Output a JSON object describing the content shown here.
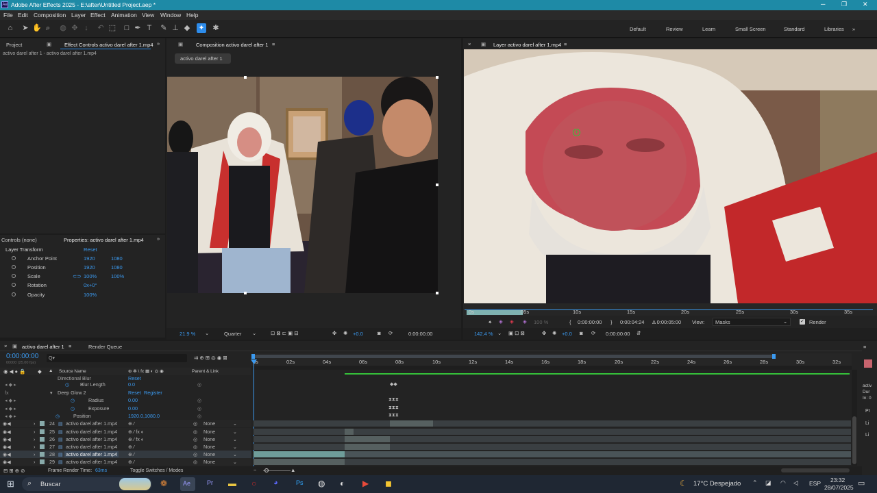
{
  "window": {
    "title": "Adobe After Effects 2025 - E:\\after\\Untitled Project.aep *",
    "min": "─",
    "max": "❐",
    "close": "✕"
  },
  "menu": [
    "File",
    "Edit",
    "Composition",
    "Layer",
    "Effect",
    "Animation",
    "View",
    "Window",
    "Help"
  ],
  "workspaces": [
    "Default",
    "Review",
    "Learn",
    "Small Screen",
    "Standard",
    "Libraries"
  ],
  "left_panel": {
    "tab_project": "Project",
    "tab_effect": "Effect Controls activo darel after 1.mp4",
    "subtitle": "activo darel after 1 - activo darel after 1.mp4"
  },
  "properties": {
    "tab_controls": "Controls (none)",
    "tab_props": "Properties: activo darel after 1.mp4",
    "section": "Layer Transform",
    "reset": "Reset",
    "rows": [
      {
        "name": "Anchor Point",
        "v1": "1920",
        "v2": "1080"
      },
      {
        "name": "Position",
        "v1": "1920",
        "v2": "1080"
      },
      {
        "name": "Scale",
        "v1": "100%",
        "v2": "100%"
      },
      {
        "name": "Rotation",
        "v1": "0x+0°",
        "v2": ""
      },
      {
        "name": "Opacity",
        "v1": "100%",
        "v2": ""
      }
    ]
  },
  "comp": {
    "tab": "Composition activo darel after 1",
    "chip": "activo darel after 1",
    "zoom": "21.9 %",
    "quality": "Quarter",
    "exposure": "+0.0",
    "time": "0:00:00:00"
  },
  "layer_panel": {
    "tab": "Layer activo darel after 1.mp4",
    "ruler": [
      "0s",
      "05s",
      "10s",
      "15s",
      "20s",
      "25s",
      "30s",
      "35s"
    ],
    "in": "0:00:00:00",
    "out": "0:00:04:24",
    "dur": "Δ 0:00:05:00",
    "view_label": "View:",
    "view": "Masks",
    "render": "Render",
    "opacity": "100 %",
    "zoom": "142.4 %",
    "exposure": "+0.0",
    "time": "0:00:00:00"
  },
  "timeline": {
    "tab": "activo darel after 1",
    "render_queue": "Render Queue",
    "timecode": "0:00:00:00",
    "fps": "00000 (25.00 fps)",
    "search": "Q▾",
    "col_source": "Source Name",
    "col_parent": "Parent & Link",
    "ruler": [
      "0s",
      "02s",
      "04s",
      "06s",
      "08s",
      "10s",
      "12s",
      "14s",
      "16s",
      "18s",
      "20s",
      "22s",
      "24s",
      "26s",
      "28s",
      "30s",
      "32s"
    ],
    "effect_rows": [
      {
        "name": "Directional Blur",
        "value": "Reset"
      },
      {
        "name": "Blur Length",
        "value": "0.0"
      },
      {
        "name": "Deep Glow 2",
        "value": "Reset",
        "extra": "Register"
      },
      {
        "name": "Radius",
        "value": "0.00"
      },
      {
        "name": "Exposure",
        "value": "0.00"
      },
      {
        "name": "Position",
        "value": "1920.0,1080.0"
      }
    ],
    "layers": [
      {
        "num": "24",
        "name": "activo darel after 1.mp4",
        "parent": "None"
      },
      {
        "num": "25",
        "name": "activo darel after 1.mp4",
        "parent": "None"
      },
      {
        "num": "26",
        "name": "activo darel after 1.mp4",
        "parent": "None"
      },
      {
        "num": "27",
        "name": "activo darel after 1.mp4",
        "parent": "None"
      },
      {
        "num": "28",
        "name": "activo darel after 1.mp4",
        "parent": "None"
      },
      {
        "num": "29",
        "name": "activo darel after 1.mp4",
        "parent": "None"
      }
    ],
    "frame_render_label": "Frame Render Time:",
    "frame_render_time": "63ms",
    "toggle": "Toggle Switches / Modes"
  },
  "right_strip": [
    "activ",
    "Dur",
    "In: 0",
    "Pr",
    "Li",
    "Li"
  ],
  "taskbar": {
    "search": "Buscar",
    "weather": "17°C  Despejado",
    "lang": "ESP",
    "time": "23:32",
    "date": "28/07/2025"
  },
  "colors": {
    "accent": "#3b9af0",
    "titlebar": "#1e8aa6",
    "green": "#35c23a"
  }
}
